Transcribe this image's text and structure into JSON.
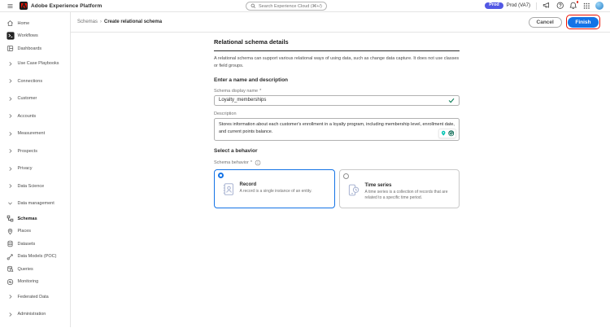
{
  "colors": {
    "accent": "#1473e6",
    "badge": "#5258e4",
    "annotation": "#ec1000",
    "valid-green": "#12805c"
  },
  "header": {
    "app_title": "Adobe Experience Platform",
    "search_placeholder": "Search Experience Cloud (⌘+/)",
    "env_badge": "Prod",
    "env_name": "Prod (VA7)"
  },
  "actionbar": {
    "breadcrumb": {
      "parent": "Schemas",
      "separator": "›",
      "current": "Create relational schema"
    },
    "cancel_label": "Cancel",
    "finish_label": "Finish"
  },
  "sidebar": {
    "items": [
      {
        "label": "Home",
        "type": "icon",
        "icon": "home"
      },
      {
        "label": "Workflows",
        "type": "icon",
        "icon": "workflows"
      },
      {
        "label": "Dashboards",
        "type": "icon",
        "icon": "dashboards"
      },
      {
        "label": "Use Case Playbooks",
        "type": "group"
      },
      {
        "label": "Connections",
        "type": "group"
      },
      {
        "label": "Customer",
        "type": "group"
      },
      {
        "label": "Accounts",
        "type": "group"
      },
      {
        "label": "Measurement",
        "type": "group"
      },
      {
        "label": "Prospects",
        "type": "group"
      },
      {
        "label": "Privacy",
        "type": "group"
      },
      {
        "label": "Data Science",
        "type": "group"
      },
      {
        "label": "Data management",
        "type": "group",
        "expanded": true
      },
      {
        "label": "Schemas",
        "type": "icon",
        "icon": "schemas",
        "active": true
      },
      {
        "label": "Places",
        "type": "icon",
        "icon": "places"
      },
      {
        "label": "Datasets",
        "type": "icon",
        "icon": "datasets"
      },
      {
        "label": "Data Models (POC)",
        "type": "icon",
        "icon": "data-models"
      },
      {
        "label": "Queries",
        "type": "icon",
        "icon": "queries"
      },
      {
        "label": "Monitoring",
        "type": "icon",
        "icon": "monitoring"
      },
      {
        "label": "Federated Data",
        "type": "group"
      },
      {
        "label": "Administration",
        "type": "group"
      }
    ]
  },
  "main": {
    "required_marker": "*",
    "title": "Relational schema details",
    "intro": "A relational schema can support various relational ways of using data, such as change data capture. It does not use classes or field groups.",
    "name_section": {
      "heading": "Enter a name and description",
      "display_name_label": "Schema display name",
      "display_name_value": "Loyalty_memberships",
      "description_label": "Description",
      "description_value": "Stores information about each customer's enrollment in a loyalty program, including membership level, enrollment date, and current points balance."
    },
    "behavior": {
      "heading": "Select a behavior",
      "label": "Schema behavior",
      "options": [
        {
          "title": "Record",
          "description": "A record is a single instance of an entity.",
          "selected": true
        },
        {
          "title": "Time series",
          "description": "A time series is a collection of records that are related to a specific time period.",
          "selected": false
        }
      ]
    }
  }
}
